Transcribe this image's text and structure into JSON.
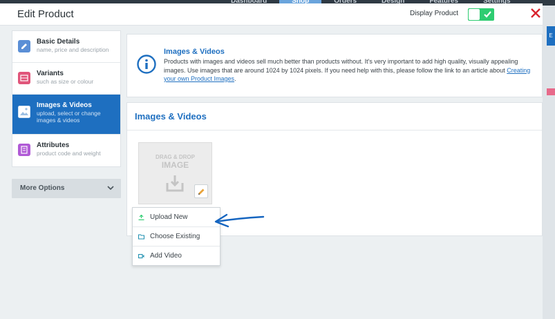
{
  "background_nav": {
    "items": [
      "Dashboard",
      "Shop",
      "Orders",
      "Design",
      "Features",
      "Settings"
    ]
  },
  "modal": {
    "title": "Edit Product",
    "display_product_label": "Display Product",
    "display_product_on": true
  },
  "sidebar": {
    "items": [
      {
        "label": "Basic Details",
        "sub": "name, price and description",
        "icon": "pencil-icon"
      },
      {
        "label": "Variants",
        "sub": "such as size or colour",
        "icon": "variants-icon"
      },
      {
        "label": "Images & Videos",
        "sub": "upload, select or change images & videos",
        "icon": "image-icon",
        "active": true
      },
      {
        "label": "Attributes",
        "sub": "product code and weight",
        "icon": "attributes-icon"
      }
    ],
    "more_options": "More Options"
  },
  "info": {
    "title": "Images & Videos",
    "body": "Products with images and videos sell much better than products without. It's very important to add high quality, visually appealing images. Use images that are around 1024 by 1024 pixels. If you need help with this, please follow the link to an article about ",
    "link": "Creating your own Product Images",
    "body_end": "."
  },
  "images_panel": {
    "title": "Images & Videos",
    "dropzone_line1": "DRAG & DROP",
    "dropzone_line2": "IMAGE"
  },
  "dropdown": {
    "items": [
      {
        "label": "Upload New",
        "icon": "upload-icon"
      },
      {
        "label": "Choose Existing",
        "icon": "folder-icon"
      },
      {
        "label": "Add Video",
        "icon": "video-icon"
      }
    ]
  },
  "colors": {
    "accent": "#1e6fc0",
    "toggle_on": "#2ecc71",
    "close": "#d9232e",
    "annotation_arrow": "#1565c0"
  }
}
